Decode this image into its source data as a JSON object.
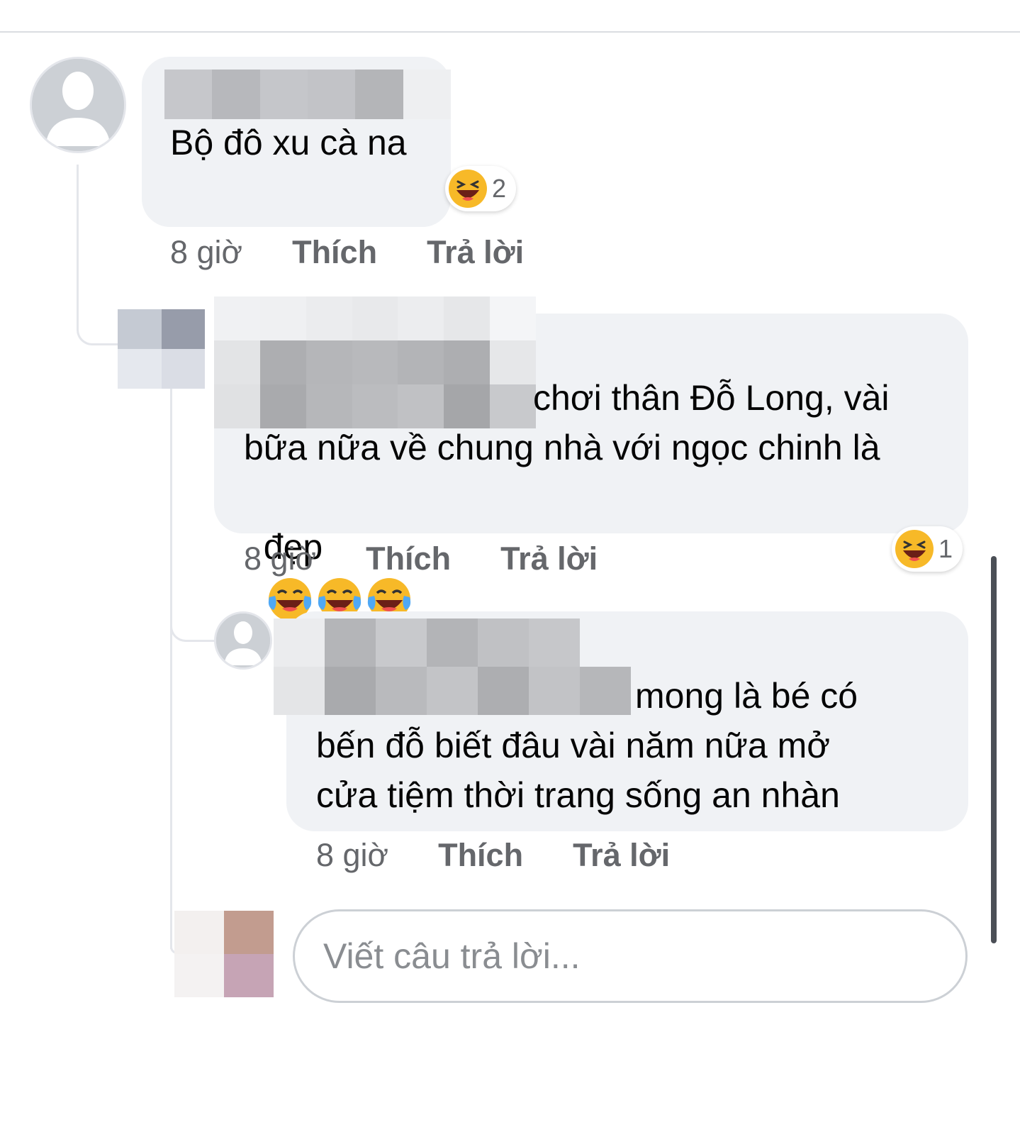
{
  "comments": [
    {
      "text": "Bộ đô xu cà na",
      "time": "8 giờ",
      "like_label": "Thích",
      "reply_label": "Trả lời",
      "reaction": {
        "icon": "laughing-emoji-icon",
        "count": "2"
      }
    },
    {
      "text_line1": "chơi thân Đỗ Long, vài",
      "text_line2": "bữa nữa về chung nhà với ngọc chinh là",
      "text_line3": "đẹp",
      "inline_emojis": [
        "face-with-tears-of-joy-icon",
        "face-with-tears-of-joy-icon",
        "face-with-tears-of-joy-icon"
      ],
      "time": "8 giờ",
      "like_label": "Thích",
      "reply_label": "Trả lời",
      "reaction": {
        "icon": "laughing-emoji-icon",
        "count": "1"
      }
    },
    {
      "text_line1": "mong là bé có",
      "text_line2": "bến đỗ biết đâu vài năm nữa mở",
      "text_line3": "cửa tiệm thời trang sống an nhàn",
      "time": "8 giờ",
      "like_label": "Thích",
      "reply_label": "Trả lời"
    }
  ],
  "reply_box": {
    "placeholder": "Viết câu trả lời..."
  },
  "colors": {
    "bubble": "#f0f2f5",
    "meta_text": "#65676b",
    "input_border": "#ccd0d5"
  }
}
